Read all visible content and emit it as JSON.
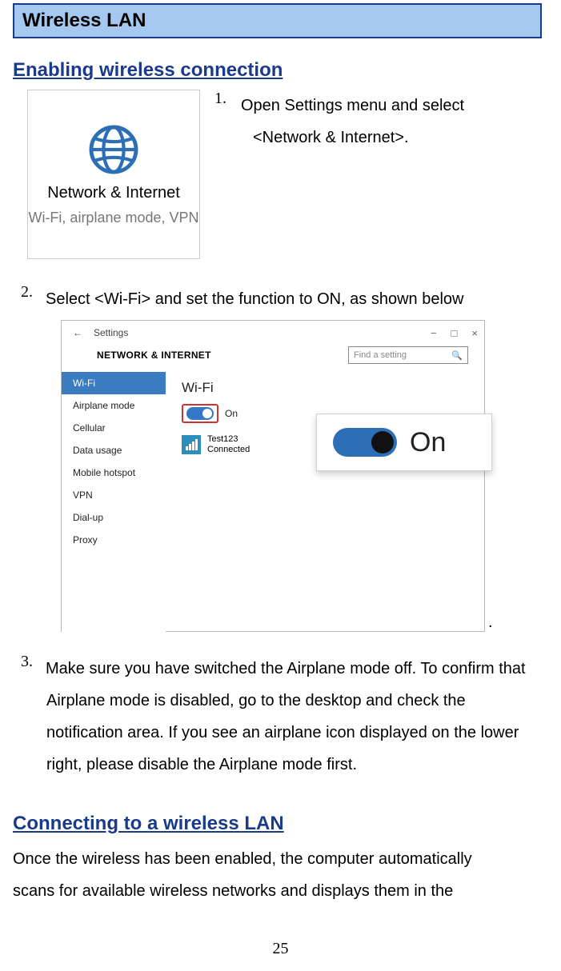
{
  "section_title": "Wireless LAN",
  "heading1": "Enabling wireless connection",
  "tile": {
    "title": "Network & Internet",
    "subtitle": "Wi-Fi, airplane mode, VPN"
  },
  "step1": {
    "num": "1.",
    "line1": "Open Settings menu and select",
    "line2": "<Network & Internet>."
  },
  "step2": {
    "num": "2.",
    "text": "Select <Wi-Fi> and set the function to ON, as shown below"
  },
  "settings_fig": {
    "back": "←",
    "app": "Settings",
    "win_min": "−",
    "win_max": "□",
    "win_close": "×",
    "title": "NETWORK & INTERNET",
    "search_placeholder": "Find a setting",
    "search_icon": "🔍",
    "sidebar": [
      "Wi-Fi",
      "Airplane mode",
      "Cellular",
      "Data usage",
      "Mobile hotspot",
      "VPN",
      "Dial-up",
      "Proxy"
    ],
    "main_title": "Wi-Fi",
    "toggle_label": "On",
    "net_name": "Test123",
    "net_status": "Connected",
    "big_label": "On"
  },
  "step3": {
    "num": "3.",
    "l1": "Make sure you have switched the Airplane mode off. To confirm that",
    "l2": "Airplane mode is disabled, go to the desktop and check the",
    "l3": "notification area. If you see an airplane icon displayed on the lower",
    "l4": "right, please disable the Airplane mode first."
  },
  "heading2": "Connecting to a wireless LAN",
  "para2_l1": "Once the wireless has been enabled, the computer automatically",
  "para2_l2": "scans for available wireless networks and displays them in the",
  "page_number": "25"
}
